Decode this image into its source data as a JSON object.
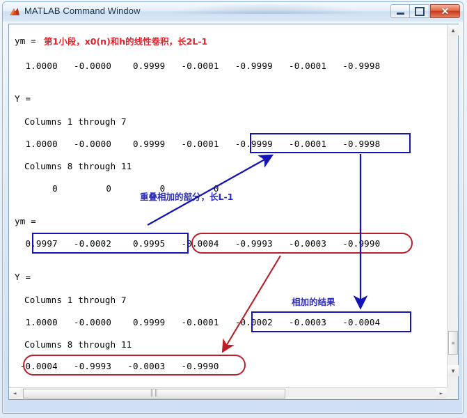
{
  "window": {
    "title": "MATLAB Command Window",
    "icon": "matlab-membrane-icon",
    "buttons": {
      "minimize": "minimize-button",
      "maximize": "maximize-button",
      "close": "✕"
    }
  },
  "console": {
    "prompt": ">>",
    "lines": [
      {
        "id": "ym1_label",
        "text": "ym ="
      },
      {
        "id": "ym1_values",
        "text": "  1.0000   -0.0000    0.9999   -0.0001   -0.9999   -0.0001   -0.9998"
      },
      {
        "id": "Y1_label",
        "text": "Y ="
      },
      {
        "id": "Y1_cols1",
        "text": "Columns 1 through 7"
      },
      {
        "id": "Y1_values1",
        "text": "  1.0000   -0.0000    0.9999   -0.0001   -0.9999   -0.0001   -0.9998"
      },
      {
        "id": "Y1_cols2",
        "text": "Columns 8 through 11"
      },
      {
        "id": "Y1_values2",
        "text": "       0         0         0         0"
      },
      {
        "id": "ym2_label",
        "text": "ym ="
      },
      {
        "id": "ym2_values",
        "text": "  0.9997   -0.0002    0.9995   -0.0004   -0.9993   -0.0003   -0.9990"
      },
      {
        "id": "Y2_label",
        "text": "Y ="
      },
      {
        "id": "Y2_cols1",
        "text": "Columns 1 through 7"
      },
      {
        "id": "Y2_values1",
        "text": "  1.0000   -0.0000    0.9999   -0.0001   -0.0002   -0.0003   -0.0004"
      },
      {
        "id": "Y2_cols2",
        "text": "Columns 8 through 11"
      },
      {
        "id": "Y2_values2",
        "text": " -0.0004   -0.9993   -0.0003   -0.9990"
      }
    ]
  },
  "annotations": {
    "first_segment": "第1小段，x0(n)和h的线性卷积，长2L-1",
    "overlap_part": "重叠相加的部分，长L-1",
    "sum_result": "相加的结果",
    "colors": {
      "red": "#e8202a",
      "blue": "#2d2dbb",
      "box_blue": "#1414b4",
      "box_red": "#b81f28"
    }
  },
  "highlights": [
    {
      "id": "blue-box-tail-Y1",
      "shape": "rect",
      "label": "Y first-row tail values"
    },
    {
      "id": "blue-box-head-ym2",
      "shape": "rect",
      "label": "ym second-row head values"
    },
    {
      "id": "red-pill-tail-ym2",
      "shape": "pill",
      "label": "ym second-row tail values"
    },
    {
      "id": "blue-box-sum-Y2",
      "shape": "rect",
      "label": "Y second-row summed values"
    },
    {
      "id": "red-pill-tail-Y2",
      "shape": "pill",
      "label": "Y second-row columns 8 through 11"
    }
  ],
  "scrollbars": {
    "vertical_up": "▲",
    "vertical_down": "▼",
    "horizontal_left": "◄",
    "horizontal_right": "►",
    "grip": "║║"
  }
}
